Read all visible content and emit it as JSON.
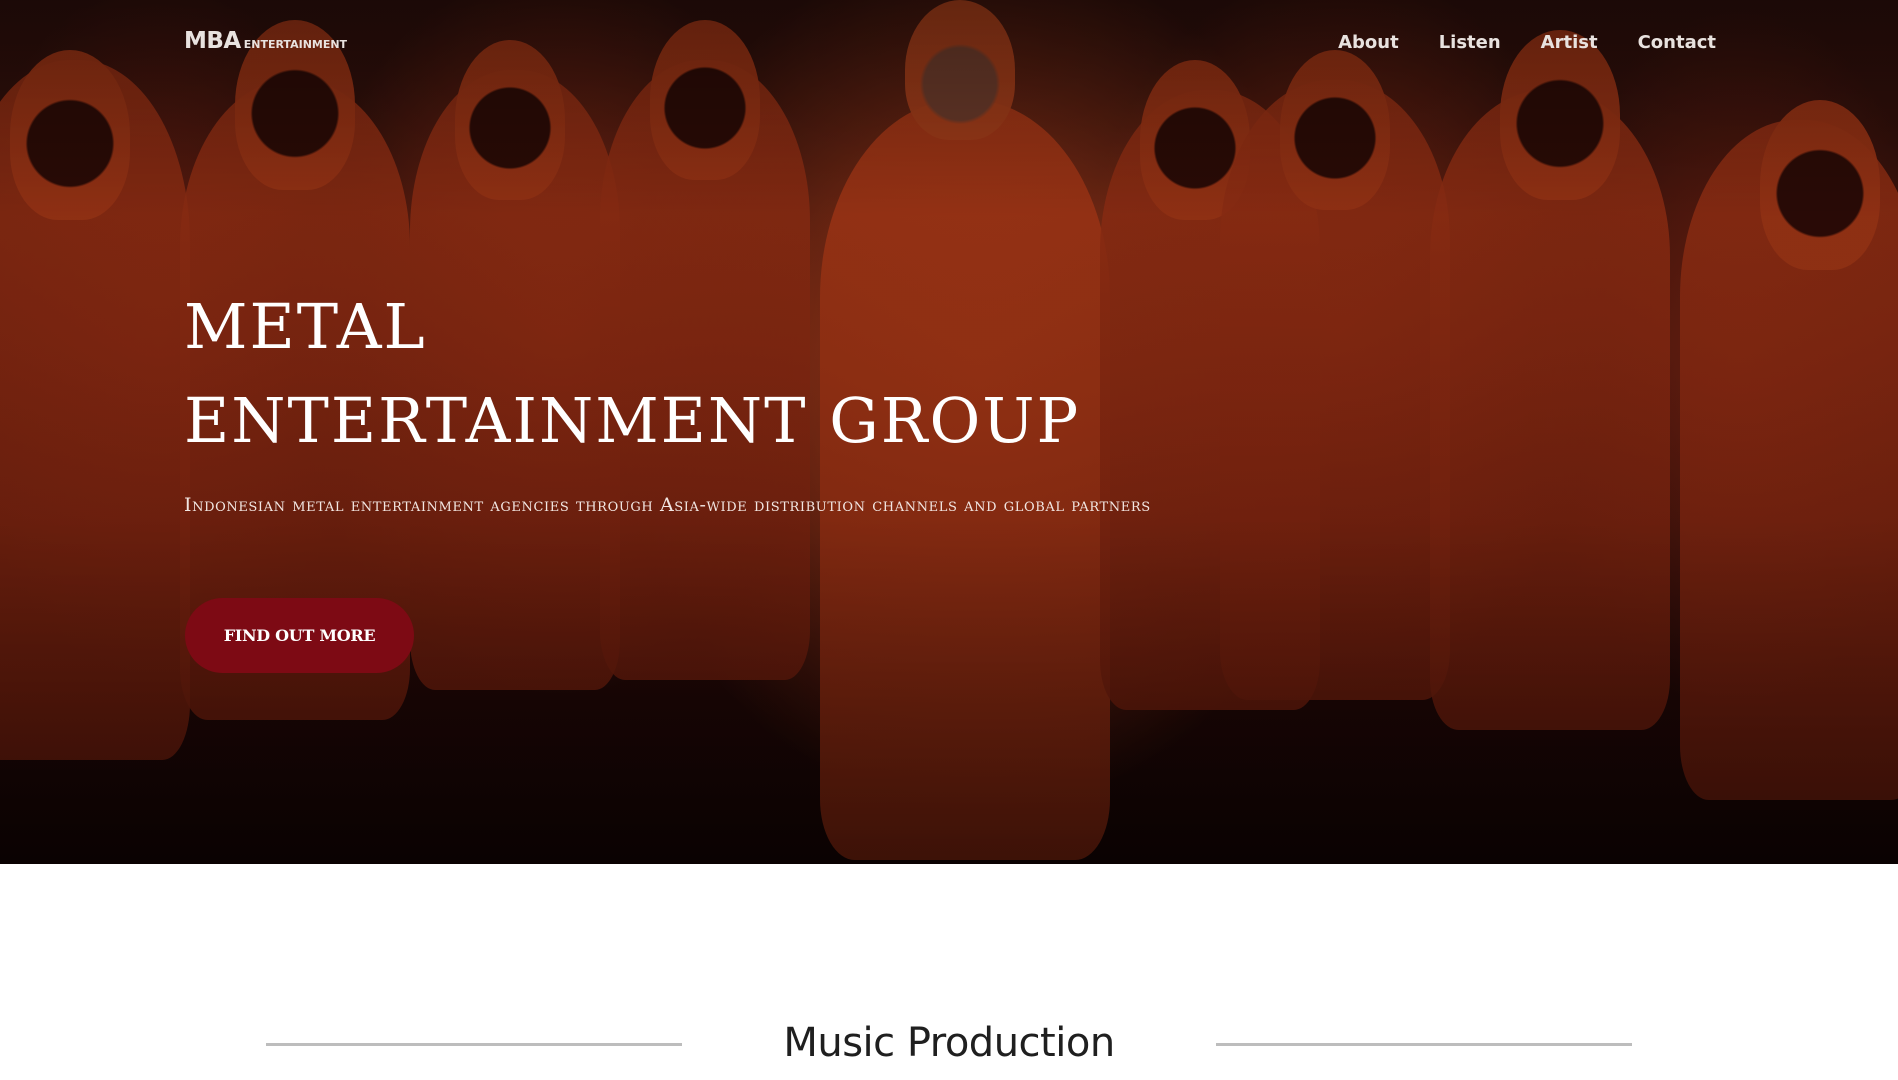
{
  "navbar": {
    "brand": "MBA",
    "brand_small": "ENTERTAINMENT",
    "links": [
      "About",
      "Listen",
      "Artist",
      "Contact"
    ]
  },
  "hero": {
    "title_line1": "METAL",
    "title_line2": "ENTERTAINMENT GROUP",
    "subtitle": "Indonesian metal entertainment agencies through Asia-wide distribution channels and global partners",
    "cta_label": "FIND OUT MORE",
    "image_alt": "hooded-figures-background"
  },
  "sections": {
    "music_production_title": "Music Production"
  },
  "colors": {
    "cta_bg": "#7d0a14",
    "nav_text": "#e8e2df",
    "rule": "#bdbdbd"
  }
}
